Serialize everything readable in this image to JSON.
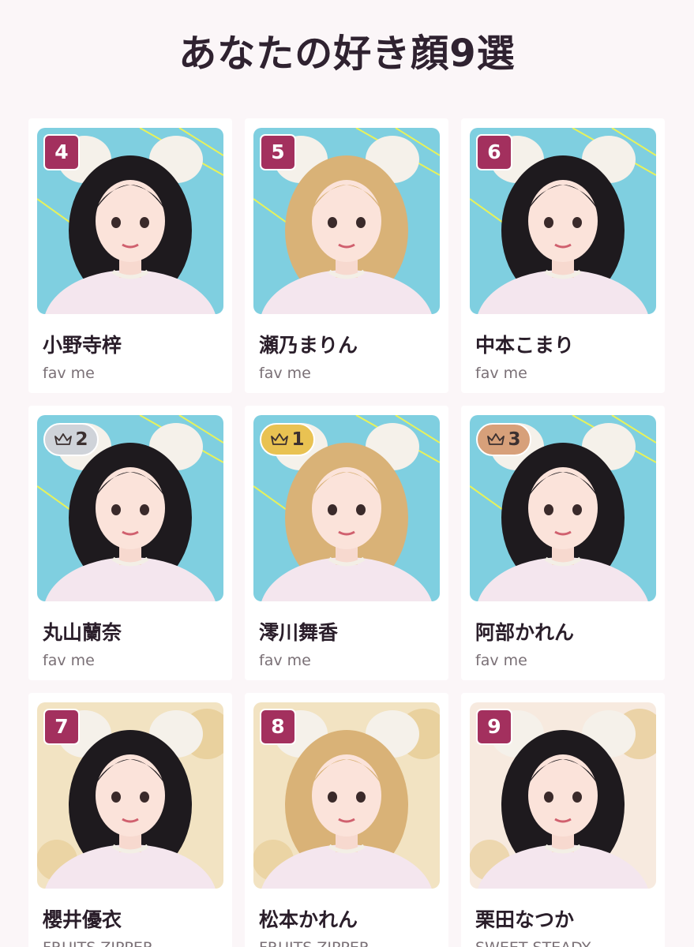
{
  "title": "あなたの好き顔9選",
  "colors": {
    "rank_badge": "#a3305e",
    "gold": "#e9c252",
    "silver": "#cfd3d9",
    "bronze": "#d7a07a",
    "photo_bg_blue": "#7fcfe0",
    "photo_bg_cream": "#f2e3c2",
    "page_bg": "#fbf6f8"
  },
  "cards": [
    {
      "rank": "4",
      "badge": "number",
      "name": "小野寺梓",
      "group": "fav me",
      "bg": "#7fcfe0"
    },
    {
      "rank": "5",
      "badge": "number",
      "name": "瀬乃まりん",
      "group": "fav me",
      "bg": "#7fcfe0"
    },
    {
      "rank": "6",
      "badge": "number",
      "name": "中本こまり",
      "group": "fav me",
      "bg": "#7fcfe0"
    },
    {
      "rank": "2",
      "badge": "silver",
      "name": "丸山蘭奈",
      "group": "fav me",
      "bg": "#7fcfe0"
    },
    {
      "rank": "1",
      "badge": "gold",
      "name": "澪川舞香",
      "group": "fav me",
      "bg": "#7fcfe0"
    },
    {
      "rank": "3",
      "badge": "bronze",
      "name": "阿部かれん",
      "group": "fav me",
      "bg": "#7fcfe0"
    },
    {
      "rank": "7",
      "badge": "number",
      "name": "櫻井優衣",
      "group": "FRUITS ZIPPER",
      "bg": "#f2e3c2"
    },
    {
      "rank": "8",
      "badge": "number",
      "name": "松本かれん",
      "group": "FRUITS ZIPPER",
      "bg": "#f2e3c2"
    },
    {
      "rank": "9",
      "badge": "number",
      "name": "栗田なつか",
      "group": "SWEET STEADY",
      "bg": "#f7eadf"
    }
  ]
}
